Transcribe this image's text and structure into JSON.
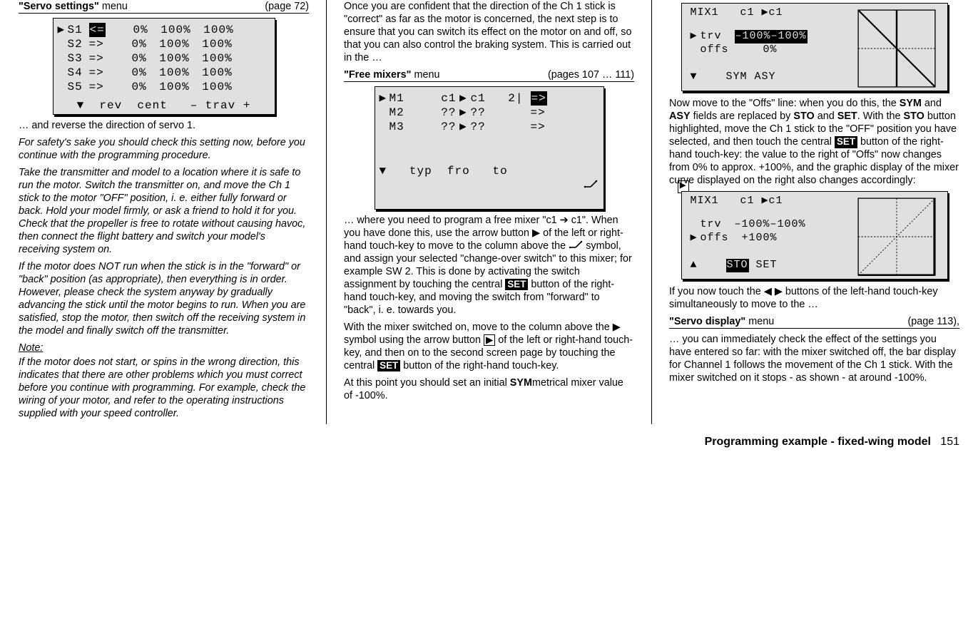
{
  "col1": {
    "menuTitle1": "\"Servo settings\"",
    "menuTitle2": " menu",
    "menuPage": "(page 72)",
    "servoTable": {
      "rows": [
        {
          "marker": "▶",
          "name": "S1",
          "dir": "<=",
          "cent": "0%",
          "t1": "100%",
          "t2": "100%",
          "dirInv": true
        },
        {
          "marker": " ",
          "name": "S2",
          "dir": "=>",
          "cent": "0%",
          "t1": "100%",
          "t2": "100%",
          "dirInv": false
        },
        {
          "marker": " ",
          "name": "S3",
          "dir": "=>",
          "cent": "0%",
          "t1": "100%",
          "t2": "100%",
          "dirInv": false
        },
        {
          "marker": " ",
          "name": "S4",
          "dir": "=>",
          "cent": "0%",
          "t1": "100%",
          "t2": "100%",
          "dirInv": false
        },
        {
          "marker": " ",
          "name": "S5",
          "dir": "=>",
          "cent": "0%",
          "t1": "100%",
          "t2": "100%",
          "dirInv": false
        }
      ],
      "footer": "▼  rev  cent   – trav +"
    },
    "p1": "… and reverse the direction of servo 1.",
    "p2": "For safety's sake you should check this setting now, before you continue with the programming procedure.",
    "p3": "Take the transmitter and model to a location where it is safe to run the motor. Switch the transmitter on, and move the Ch 1 stick to the motor \"OFF\" position, i. e. either fully forward or back. Hold your model firmly, or ask a friend to hold it for you. Check that the propeller is free to rotate without causing havoc, then connect the flight battery and switch your model's receiving system on.",
    "p4": "If the motor does NOT run when the stick is in the \"forward\" or \"back\" position (as appropriate), then everything is in order. However, please check the system anyway by gradually advancing the stick until the motor begins to run. When you are satisfied, stop the motor, then switch off the receiving system in the model and finally switch off the transmitter.",
    "noteLabel": "Note:",
    "note": "If the motor does not start, or spins in the wrong direction, this indicates that there are other problems which you must correct before you continue with programming. For example, check the wiring of your motor, and refer to the operating instructions supplied with your speed controller."
  },
  "col2": {
    "intro": "Once you are confident that the direction of the Ch 1 stick is \"correct\" as far as the motor is concerned, the next step is to ensure that you can switch its effect on the motor on and off, so that you can also control the braking system. This is carried out in the …",
    "menuTitle1": "\"Free mixers\"",
    "menuTitle2": " menu",
    "menuPage": "(pages 107 … 111)",
    "mixTable": {
      "r1": {
        "marker": "▶",
        "m": "M1",
        "from": "c1",
        "arrow": "▶",
        "to": "c1",
        "sw": "2|",
        "mode": "=>",
        "modeInv": true
      },
      "r2": {
        "marker": " ",
        "m": "M2",
        "from": "??",
        "arrow": "▶",
        "to": "??",
        "sw": "  ",
        "mode": "=>",
        "modeInv": false
      },
      "r3": {
        "marker": " ",
        "m": "M3",
        "from": "??",
        "arrow": "▶",
        "to": "??",
        "sw": "  ",
        "mode": "=>",
        "modeInv": false
      },
      "footer": "▼   typ  fro   to"
    },
    "p_a": "… where you need to program a free mixer \"c1 ➔ c1\". When you have done this, use the arrow button ▶ of the left or right-hand touch-key to move to the column above the ",
    "p_b": " symbol, and assign your selected \"change-over switch\" to this mixer; for example SW 2. This is done by activating the switch assignment by touching the central ",
    "p_c": " button of the right-hand touch-key, and moving the switch from \"forward\" to \"back\", i. e. towards you.",
    "p2a": "With the mixer switched on, move to the column above the ▶ symbol using the arrow button ",
    "p2b": " of the left or right-hand touch-key, and then on to the second screen page by touching the central ",
    "p2c": " button of the right-hand touch-key.",
    "p3a": "At this point you should set an initial ",
    "p3b": "SYM",
    "p3c": "metrical mixer value of -100%.",
    "set": "SET"
  },
  "col3": {
    "mix1": {
      "title": "MIX1   c1 ▶c1",
      "r1": {
        "marker": "▶",
        "label": "trv",
        "vals": "–100%–100%",
        "valsInv": true
      },
      "r2": {
        "marker": " ",
        "label": "offs",
        "vals": "    0%",
        "valsInv": false
      },
      "footer": "▼    SYM ASY"
    },
    "p1a": "Now move to the \"Offs\" line: when you do this, the ",
    "p1SYM": "SYM",
    "p1b": " and ",
    "p1ASY": "ASY",
    "p1c": " fields are replaced by ",
    "p1STO": "STO",
    "p1d": " and ",
    "p1SET": "SET",
    "p1e": ". With the ",
    "p1STO2": "STO",
    "p1f": " button highlighted, move the Ch 1 stick to the \"OFF\" position you have selected, and then touch the central ",
    "p1g": " button of the right-hand touch-key: the value to the right of \"Offs\" now changes from 0% to approx. +100%, and the graphic display of the mixer curve displayed on the right also changes accordingly:",
    "set": "SET",
    "mix2": {
      "title": "MIX1   c1 ▶c1",
      "r1": {
        "marker": " ",
        "label": "trv",
        "vals": "–100%–100%",
        "valsInv": false
      },
      "r2": {
        "marker": "▶",
        "label": "offs",
        "vals": " +100%",
        "valsInv": false
      },
      "footerPre": "▲    ",
      "footerSTO": "STO",
      "footerPost": " SET"
    },
    "p2": "If you now touch the ◀ ▶ buttons of the left-hand touch-key simultaneously to move to the …",
    "menuTitle1": "\"Servo display\"",
    "menuTitle2": " menu",
    "menuPage": "(page 113),",
    "p3": "… you can immediately check the effect of the settings you have entered so far: with the mixer switched off, the bar display for Channel 1 follows the movement of the Ch 1 stick. With the mixer switched on it stops - as shown - at around -100%."
  },
  "footer": {
    "title": "Programming example - fixed-wing model",
    "page": "151"
  }
}
